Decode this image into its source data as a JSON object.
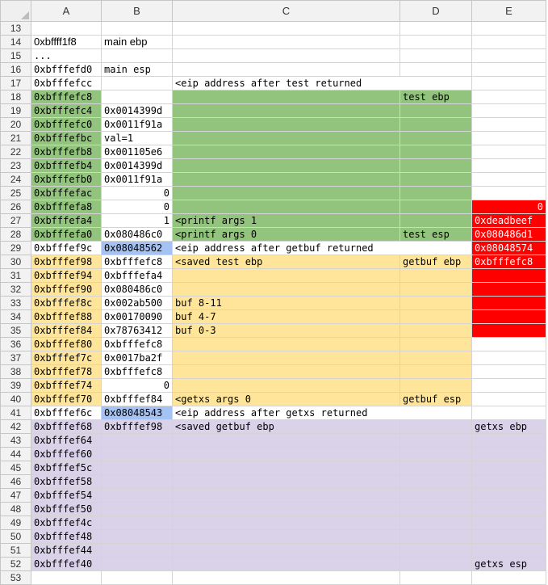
{
  "columns": [
    "A",
    "B",
    "C",
    "D",
    "E"
  ],
  "rows": [
    {
      "n": "13",
      "cells": [
        {
          "t": ""
        },
        {
          "t": ""
        },
        {
          "t": ""
        },
        {
          "t": ""
        },
        {
          "t": ""
        }
      ]
    },
    {
      "n": "14",
      "cells": [
        {
          "t": "0xbffff1f8",
          "f": "sans"
        },
        {
          "t": "main ebp",
          "f": "sans"
        },
        {
          "t": ""
        },
        {
          "t": ""
        },
        {
          "t": ""
        }
      ]
    },
    {
      "n": "15",
      "cells": [
        {
          "t": "..."
        },
        {
          "t": ""
        },
        {
          "t": ""
        },
        {
          "t": ""
        },
        {
          "t": ""
        }
      ]
    },
    {
      "n": "16",
      "cells": [
        {
          "t": "0xbfffefd0"
        },
        {
          "t": "main esp"
        },
        {
          "t": ""
        },
        {
          "t": ""
        },
        {
          "t": ""
        }
      ]
    },
    {
      "n": "17",
      "cells": [
        {
          "t": "0xbfffefcc"
        },
        {
          "t": ""
        },
        {
          "t": "<eip address after test returned",
          "span": 2
        },
        {
          "t": ""
        }
      ]
    },
    {
      "n": "18",
      "cells": [
        {
          "t": "0xbfffefc8",
          "c": "g"
        },
        {
          "t": ""
        },
        {
          "t": "",
          "c": "g"
        },
        {
          "t": "test ebp",
          "c": "g"
        },
        {
          "t": ""
        }
      ]
    },
    {
      "n": "19",
      "cells": [
        {
          "t": "0xbfffefc4",
          "c": "g"
        },
        {
          "t": "0x0014399d"
        },
        {
          "t": "",
          "c": "g"
        },
        {
          "t": "",
          "c": "g"
        },
        {
          "t": ""
        }
      ]
    },
    {
      "n": "20",
      "cells": [
        {
          "t": "0xbfffefc0",
          "c": "g"
        },
        {
          "t": "0x0011f91a"
        },
        {
          "t": "",
          "c": "g"
        },
        {
          "t": "",
          "c": "g"
        },
        {
          "t": ""
        }
      ]
    },
    {
      "n": "21",
      "cells": [
        {
          "t": "0xbfffefbc",
          "c": "g"
        },
        {
          "t": "val=1"
        },
        {
          "t": "",
          "c": "g"
        },
        {
          "t": "",
          "c": "g"
        },
        {
          "t": ""
        }
      ]
    },
    {
      "n": "22",
      "cells": [
        {
          "t": "0xbfffefb8",
          "c": "g"
        },
        {
          "t": "0x001105e6"
        },
        {
          "t": "",
          "c": "g"
        },
        {
          "t": "",
          "c": "g"
        },
        {
          "t": ""
        }
      ]
    },
    {
      "n": "23",
      "cells": [
        {
          "t": "0xbfffefb4",
          "c": "g"
        },
        {
          "t": "0x0014399d"
        },
        {
          "t": "",
          "c": "g"
        },
        {
          "t": "",
          "c": "g"
        },
        {
          "t": ""
        }
      ]
    },
    {
      "n": "24",
      "cells": [
        {
          "t": "0xbfffefb0",
          "c": "g"
        },
        {
          "t": "0x0011f91a"
        },
        {
          "t": "",
          "c": "g"
        },
        {
          "t": "",
          "c": "g"
        },
        {
          "t": ""
        }
      ]
    },
    {
      "n": "25",
      "cells": [
        {
          "t": "0xbfffefac",
          "c": "g"
        },
        {
          "t": "0",
          "num": true
        },
        {
          "t": "",
          "c": "g"
        },
        {
          "t": "",
          "c": "g"
        },
        {
          "t": ""
        }
      ]
    },
    {
      "n": "26",
      "cells": [
        {
          "t": "0xbfffefa8",
          "c": "g"
        },
        {
          "t": "0",
          "num": true
        },
        {
          "t": "",
          "c": "g"
        },
        {
          "t": "",
          "c": "g"
        },
        {
          "t": "0",
          "c": "r",
          "num": true
        }
      ]
    },
    {
      "n": "27",
      "cells": [
        {
          "t": "0xbfffefa4",
          "c": "g"
        },
        {
          "t": "1",
          "num": true
        },
        {
          "t": "<printf args 1",
          "c": "g"
        },
        {
          "t": "",
          "c": "g"
        },
        {
          "t": "0xdeadbeef",
          "c": "r"
        }
      ]
    },
    {
      "n": "28",
      "cells": [
        {
          "t": "0xbfffefa0",
          "c": "g"
        },
        {
          "t": "0x080486c0"
        },
        {
          "t": "<printf args 0",
          "c": "g"
        },
        {
          "t": "test esp",
          "c": "g"
        },
        {
          "t": "0x080486d1",
          "c": "r"
        }
      ]
    },
    {
      "n": "29",
      "cells": [
        {
          "t": "0xbfffef9c"
        },
        {
          "t": "0x08048562",
          "c": "sel"
        },
        {
          "t": "<eip address after getbuf returned",
          "span": 2
        },
        {
          "t": "0x08048574",
          "c": "r"
        }
      ]
    },
    {
      "n": "30",
      "cells": [
        {
          "t": "0xbfffef98",
          "c": "y"
        },
        {
          "t": "0xbfffefc8"
        },
        {
          "t": "<saved test ebp",
          "c": "y"
        },
        {
          "t": "getbuf ebp",
          "c": "y"
        },
        {
          "t": "0xbfffefc8",
          "c": "r"
        }
      ]
    },
    {
      "n": "31",
      "cells": [
        {
          "t": "0xbfffef94",
          "c": "y"
        },
        {
          "t": "0xbfffefa4"
        },
        {
          "t": "",
          "c": "y"
        },
        {
          "t": "",
          "c": "y"
        },
        {
          "t": "",
          "c": "r"
        }
      ]
    },
    {
      "n": "32",
      "cells": [
        {
          "t": "0xbfffef90",
          "c": "y"
        },
        {
          "t": "0x080486c0"
        },
        {
          "t": "",
          "c": "y"
        },
        {
          "t": "",
          "c": "y"
        },
        {
          "t": "",
          "c": "r"
        }
      ]
    },
    {
      "n": "33",
      "cells": [
        {
          "t": "0xbfffef8c",
          "c": "y"
        },
        {
          "t": "0x002ab500"
        },
        {
          "t": "buf 8-11",
          "c": "y"
        },
        {
          "t": "",
          "c": "y"
        },
        {
          "t": "",
          "c": "r"
        }
      ]
    },
    {
      "n": "34",
      "cells": [
        {
          "t": "0xbfffef88",
          "c": "y"
        },
        {
          "t": "0x00170090"
        },
        {
          "t": "buf 4-7",
          "c": "y"
        },
        {
          "t": "",
          "c": "y"
        },
        {
          "t": "",
          "c": "r"
        }
      ]
    },
    {
      "n": "35",
      "cells": [
        {
          "t": "0xbfffef84",
          "c": "y"
        },
        {
          "t": "0x78763412"
        },
        {
          "t": "buf 0-3",
          "c": "y"
        },
        {
          "t": "",
          "c": "y"
        },
        {
          "t": "",
          "c": "r"
        }
      ]
    },
    {
      "n": "36",
      "cells": [
        {
          "t": "0xbfffef80",
          "c": "y"
        },
        {
          "t": "0xbfffefc8"
        },
        {
          "t": "",
          "c": "y"
        },
        {
          "t": "",
          "c": "y"
        },
        {
          "t": ""
        }
      ]
    },
    {
      "n": "37",
      "cells": [
        {
          "t": "0xbfffef7c",
          "c": "y"
        },
        {
          "t": "0x0017ba2f"
        },
        {
          "t": "",
          "c": "y"
        },
        {
          "t": "",
          "c": "y"
        },
        {
          "t": ""
        }
      ]
    },
    {
      "n": "38",
      "cells": [
        {
          "t": "0xbfffef78",
          "c": "y"
        },
        {
          "t": "0xbfffefc8"
        },
        {
          "t": "",
          "c": "y"
        },
        {
          "t": "",
          "c": "y"
        },
        {
          "t": ""
        }
      ]
    },
    {
      "n": "39",
      "cells": [
        {
          "t": "0xbfffef74",
          "c": "y"
        },
        {
          "t": "0",
          "num": true
        },
        {
          "t": "",
          "c": "y"
        },
        {
          "t": "",
          "c": "y"
        },
        {
          "t": ""
        }
      ]
    },
    {
      "n": "40",
      "cells": [
        {
          "t": "0xbfffef70",
          "c": "y"
        },
        {
          "t": "0xbfffef84"
        },
        {
          "t": "<getxs args 0",
          "c": "y"
        },
        {
          "t": "getbuf esp",
          "c": "y"
        },
        {
          "t": ""
        }
      ]
    },
    {
      "n": "41",
      "cells": [
        {
          "t": "0xbfffef6c"
        },
        {
          "t": "0x08048543",
          "c": "sel"
        },
        {
          "t": "<eip address after getxs returned",
          "span": 2
        },
        {
          "t": ""
        }
      ]
    },
    {
      "n": "42",
      "cells": [
        {
          "t": "0xbfffef68",
          "c": "p"
        },
        {
          "t": "0xbfffef98",
          "c": "p"
        },
        {
          "t": "<saved getbuf ebp",
          "c": "p"
        },
        {
          "t": "",
          "c": "p"
        },
        {
          "t": "getxs ebp",
          "c": "p"
        }
      ]
    },
    {
      "n": "43",
      "cells": [
        {
          "t": "0xbfffef64",
          "c": "p"
        },
        {
          "t": "",
          "c": "p"
        },
        {
          "t": "",
          "c": "p"
        },
        {
          "t": "",
          "c": "p"
        },
        {
          "t": "",
          "c": "p"
        }
      ]
    },
    {
      "n": "44",
      "cells": [
        {
          "t": "0xbfffef60",
          "c": "p"
        },
        {
          "t": "",
          "c": "p"
        },
        {
          "t": "",
          "c": "p"
        },
        {
          "t": "",
          "c": "p"
        },
        {
          "t": "",
          "c": "p"
        }
      ]
    },
    {
      "n": "45",
      "cells": [
        {
          "t": "0xbfffef5c",
          "c": "p"
        },
        {
          "t": "",
          "c": "p"
        },
        {
          "t": "",
          "c": "p"
        },
        {
          "t": "",
          "c": "p"
        },
        {
          "t": "",
          "c": "p"
        }
      ]
    },
    {
      "n": "46",
      "cells": [
        {
          "t": "0xbfffef58",
          "c": "p"
        },
        {
          "t": "",
          "c": "p"
        },
        {
          "t": "",
          "c": "p"
        },
        {
          "t": "",
          "c": "p"
        },
        {
          "t": "",
          "c": "p"
        }
      ]
    },
    {
      "n": "47",
      "cells": [
        {
          "t": "0xbfffef54",
          "c": "p"
        },
        {
          "t": "",
          "c": "p"
        },
        {
          "t": "",
          "c": "p"
        },
        {
          "t": "",
          "c": "p"
        },
        {
          "t": "",
          "c": "p"
        }
      ]
    },
    {
      "n": "48",
      "cells": [
        {
          "t": "0xbfffef50",
          "c": "p"
        },
        {
          "t": "",
          "c": "p"
        },
        {
          "t": "",
          "c": "p"
        },
        {
          "t": "",
          "c": "p"
        },
        {
          "t": "",
          "c": "p"
        }
      ]
    },
    {
      "n": "49",
      "cells": [
        {
          "t": "0xbfffef4c",
          "c": "p"
        },
        {
          "t": "",
          "c": "p"
        },
        {
          "t": "",
          "c": "p"
        },
        {
          "t": "",
          "c": "p"
        },
        {
          "t": "",
          "c": "p"
        }
      ]
    },
    {
      "n": "50",
      "cells": [
        {
          "t": "0xbfffef48",
          "c": "p"
        },
        {
          "t": "",
          "c": "p"
        },
        {
          "t": "",
          "c": "p"
        },
        {
          "t": "",
          "c": "p"
        },
        {
          "t": "",
          "c": "p"
        }
      ]
    },
    {
      "n": "51",
      "cells": [
        {
          "t": "0xbfffef44",
          "c": "p"
        },
        {
          "t": "",
          "c": "p"
        },
        {
          "t": "",
          "c": "p"
        },
        {
          "t": "",
          "c": "p"
        },
        {
          "t": "",
          "c": "p"
        }
      ]
    },
    {
      "n": "52",
      "cells": [
        {
          "t": "0xbfffef40",
          "c": "p"
        },
        {
          "t": "",
          "c": "p"
        },
        {
          "t": "",
          "c": "p"
        },
        {
          "t": "",
          "c": "p"
        },
        {
          "t": "getxs esp",
          "c": "p"
        }
      ]
    },
    {
      "n": "53",
      "cells": [
        {
          "t": ""
        },
        {
          "t": ""
        },
        {
          "t": ""
        },
        {
          "t": ""
        },
        {
          "t": ""
        }
      ]
    }
  ]
}
